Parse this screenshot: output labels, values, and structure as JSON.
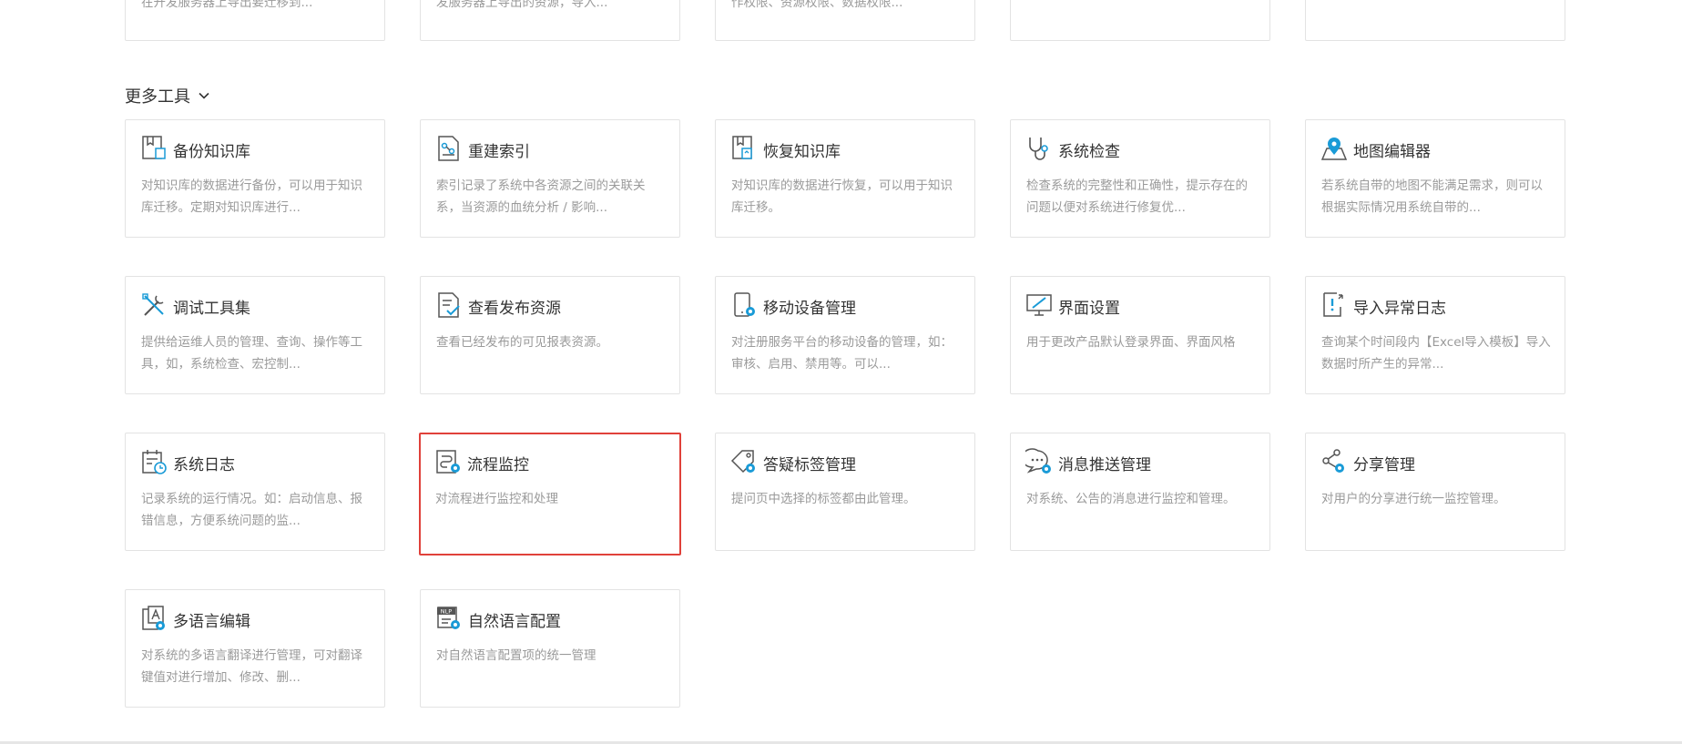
{
  "top_row": [
    {
      "desc": "在开发服务器上导出要迁移到..."
    },
    {
      "desc": "发服务器上导出的资源，导入..."
    },
    {
      "desc": "作权限、资源权限、数据权限..."
    },
    {
      "desc": ""
    },
    {
      "desc": ""
    }
  ],
  "section": {
    "title": "更多工具"
  },
  "tools": [
    {
      "title": "备份知识库",
      "desc": "对知识库的数据进行备份，可以用于知识库迁移。定期对知识库进行...",
      "icon": "backup-icon"
    },
    {
      "title": "重建索引",
      "desc": "索引记录了系统中各资源之间的关联关系，当资源的血统分析 / 影响...",
      "icon": "rebuild-index-icon"
    },
    {
      "title": "恢复知识库",
      "desc": "对知识库的数据进行恢复，可以用于知识库迁移。",
      "icon": "restore-icon"
    },
    {
      "title": "系统检查",
      "desc": "检查系统的完整性和正确性，提示存在的问题以便对系统进行修复优...",
      "icon": "stethoscope-icon"
    },
    {
      "title": "地图编辑器",
      "desc": "若系统自带的地图不能满足需求，则可以根据实际情况用系统自带的...",
      "icon": "map-pin-icon"
    },
    {
      "title": "调试工具集",
      "desc": "提供给运维人员的管理、查询、操作等工具，如，系统检查、宏控制...",
      "icon": "tools-icon"
    },
    {
      "title": "查看发布资源",
      "desc": "查看已经发布的可见报表资源。",
      "icon": "published-doc-icon"
    },
    {
      "title": "移动设备管理",
      "desc": "对注册服务平台的移动设备的管理，如：审核、启用、禁用等。可以...",
      "icon": "mobile-gear-icon"
    },
    {
      "title": "界面设置",
      "desc": "用于更改产品默认登录界面、界面风格",
      "icon": "monitor-brush-icon"
    },
    {
      "title": "导入异常日志",
      "desc": "查询某个时间段内【Excel导入模板】导入数据时所产生的异常...",
      "icon": "import-error-log-icon"
    },
    {
      "title": "系统日志",
      "desc": "记录系统的运行情况。如：启动信息、报错信息，方便系统问题的监...",
      "icon": "calendar-clock-icon"
    },
    {
      "title": "流程监控",
      "desc": "对流程进行监控和处理",
      "icon": "flow-monitor-icon"
    },
    {
      "title": "答疑标签管理",
      "desc": "提问页中选择的标签都由此管理。",
      "icon": "tag-gear-icon"
    },
    {
      "title": "消息推送管理",
      "desc": "对系统、公告的消息进行监控和管理。",
      "icon": "chat-gear-icon"
    },
    {
      "title": "分享管理",
      "desc": "对用户的分享进行统一监控管理。",
      "icon": "share-gear-icon"
    },
    {
      "title": "多语言编辑",
      "desc": "对系统的多语言翻译进行管理，可对翻译键值对进行增加、修改、删...",
      "icon": "language-gear-icon"
    },
    {
      "title": "自然语言配置",
      "desc": "对自然语言配置项的统一管理",
      "icon": "nlp-gear-icon"
    }
  ],
  "highlight_index": 11,
  "colors": {
    "accent": "#1a9bd7",
    "highlight": "#e0413a",
    "icon_stroke": "#555555"
  }
}
